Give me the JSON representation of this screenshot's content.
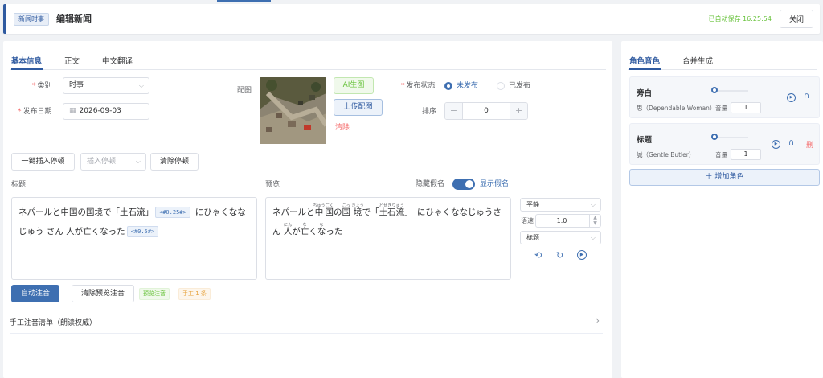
{
  "header": {
    "badge": "新闻时事",
    "title": "编辑新闻",
    "saved_status": "已自动保存 16:25:54",
    "close_label": "关闭"
  },
  "left_tabs": [
    "基本信息",
    "正文",
    "中文翻译"
  ],
  "form": {
    "category_label": "类别",
    "category_value": "时事",
    "date_label": "发布日期",
    "date_value": "2026-09-03",
    "image_label": "配图",
    "ai_image_label": "AI生图",
    "upload_image_label": "上传配图",
    "clear_label": "清除",
    "status_label": "发布状态",
    "status_options": [
      "未发布",
      "已发布"
    ],
    "order_label": "排序",
    "order_value": "0"
  },
  "pause_toolbar": {
    "insert_label": "一键插入停顿",
    "insert_select_placeholder": "插入停顿",
    "clear_label": "清除停顿"
  },
  "title_section": {
    "label": "标题",
    "text_a": "ネパールと中国の国境で「土石流」",
    "tag1": "<#0.25#>",
    "text_b": "にひゃくななじゅう さん 人が亡くなった",
    "tag2": "<#0.5#>"
  },
  "preview": {
    "label": "预览",
    "hide_kana_label": "隐藏假名",
    "show_kana_label": "显示假名",
    "text": {
      "p1": "ネパールと",
      "k1": "中",
      "k1r": "ちゅう",
      "k2": "国",
      "k2r": "ごく",
      "p2": "の",
      "k3": "国",
      "k3r": "こっ",
      "p3": " ",
      "k4": "境",
      "k4r": "きょう",
      "p4": "で「",
      "k5": "土石流",
      "k5r": "どせきりゅう",
      "p5": "」　にひゃくななじゅ",
      "p6": "うさん ",
      "k6": "人",
      "k6r": "にん",
      "p7": "が",
      "k7": "亡",
      "k7r": "な",
      "p8": "く",
      "k8": "な",
      "k8r": "な",
      "p9": "った"
    }
  },
  "voice": {
    "style_value": "平静",
    "speed_label": "语速",
    "speed_value": "1.0",
    "target_value": "标题"
  },
  "annotation": {
    "auto_label": "自动注音",
    "clear_preview_label": "清除预览注音",
    "chip_preview": "预览注音",
    "chip_manual": "手工 1 条"
  },
  "manual_list_label": "手工注音清单（朗读权威）",
  "right_tabs": [
    "角色音色",
    "合并生成"
  ],
  "roles": [
    {
      "name": "旁白",
      "voice": "思（Dependable Woman）",
      "volume_label": "音量",
      "volume": "1",
      "volume_slider": 0,
      "deletable": false
    },
    {
      "name": "标题",
      "voice": "誠（Gentle Butler）",
      "volume_label": "音量",
      "volume": "1",
      "volume_slider": 0,
      "deletable": true,
      "delete_label": "删"
    }
  ],
  "add_role_label": "＋ 增加角色",
  "icons": {
    "chevron": "chevron-down-icon",
    "calendar": "calendar-icon"
  },
  "colors": {
    "brand": "#3e6fb1",
    "success": "#67c23a",
    "danger": "#f56c6c",
    "warning": "#e6a23c"
  }
}
